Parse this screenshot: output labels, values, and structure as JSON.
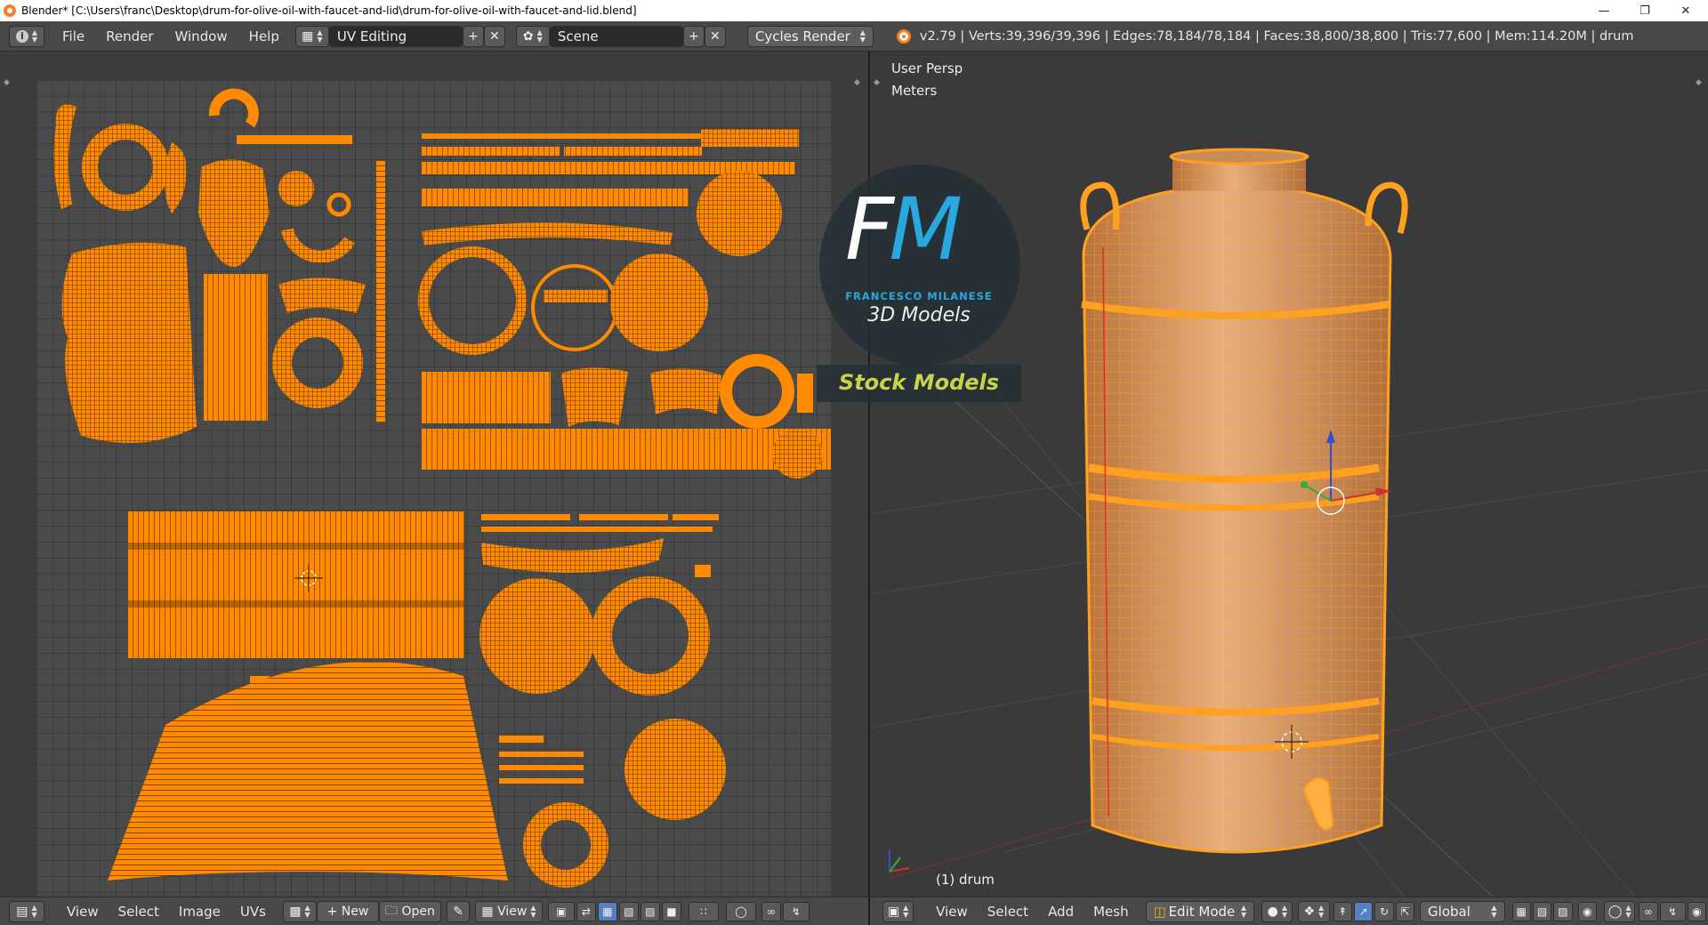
{
  "window": {
    "title": "Blender* [C:\\Users\\franc\\Desktop\\drum-for-olive-oil-with-faucet-and-lid\\drum-for-olive-oil-with-faucet-and-lid.blend]",
    "minimize_icon": "minimize-icon",
    "restore_icon": "restore-icon",
    "close_icon": "close-icon"
  },
  "info_header": {
    "menus": [
      "File",
      "Render",
      "Window",
      "Help"
    ],
    "screen_layout": "UV Editing",
    "scene": "Scene",
    "render_engine": "Cycles Render",
    "stats": "v2.79 | Verts:39,396/39,396 | Edges:78,184/78,184 | Faces:38,800/38,800 | Tris:77,600 | Mem:114.20M | drum"
  },
  "uv_footer": {
    "menus": [
      "View",
      "Select",
      "Image",
      "UVs"
    ],
    "new_label": "New",
    "open_label": "Open",
    "view_label": "View"
  },
  "viewport": {
    "view_name": "User Persp",
    "units": "Meters",
    "object_label": "(1) drum"
  },
  "viewport_footer": {
    "menus": [
      "View",
      "Select",
      "Add",
      "Mesh"
    ],
    "mode": "Edit Mode",
    "orientation": "Global"
  },
  "watermark": {
    "initials_f": "F",
    "initials_m": "M",
    "name": "FRANCESCO MILANESE",
    "subtitle": "3D Models",
    "tagline": "Stock Models"
  },
  "colors": {
    "uv_orange": "#ff8a00",
    "mesh_orange": "#ffa020",
    "background": "#3d3d3d",
    "header": "#484848",
    "accent_blue": "#29a8e0"
  }
}
